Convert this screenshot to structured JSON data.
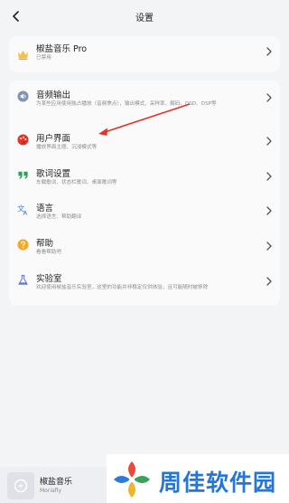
{
  "header": {
    "title": "设置"
  },
  "pro": {
    "title": "椒盐音乐 Pro",
    "subtitle": "已禁用"
  },
  "settings": [
    {
      "key": "audio",
      "title": "音频输出",
      "subtitle": "为某些应用使用独占播放（音频焦点），输出模式、采样率、解码、DSD、DSP等"
    },
    {
      "key": "ui",
      "title": "用户界面",
      "subtitle": "播放界面主题、沉浸模式等"
    },
    {
      "key": "lyrics",
      "title": "歌词设置",
      "subtitle": "车载歌词、状态栏歌词、桌面歌词等"
    },
    {
      "key": "language",
      "title": "语言",
      "subtitle": "选择语言、帮助翻译"
    },
    {
      "key": "help",
      "title": "帮助",
      "subtitle": "看看帮助吧"
    },
    {
      "key": "lab",
      "title": "实验室",
      "subtitle": "欢迎使用椒盐音乐实验室，这里的功能并非稳定仅供体验，且可能随时被移除"
    }
  ],
  "player": {
    "title": "椒盐音乐",
    "subtitle": "Moriafly"
  },
  "watermark": {
    "text": "周佳软件园"
  },
  "colors": {
    "accent_red": "#e0352b",
    "watermark_blue": "#2477d9"
  },
  "icons": {
    "back": "chevron-left-icon",
    "pro": "crown-icon",
    "audio": "speaker-icon",
    "ui": "palette-icon",
    "lyrics": "quote-icon",
    "language": "translate-icon",
    "help": "help-icon",
    "lab": "flask-icon",
    "row": "chevron-right-icon"
  }
}
